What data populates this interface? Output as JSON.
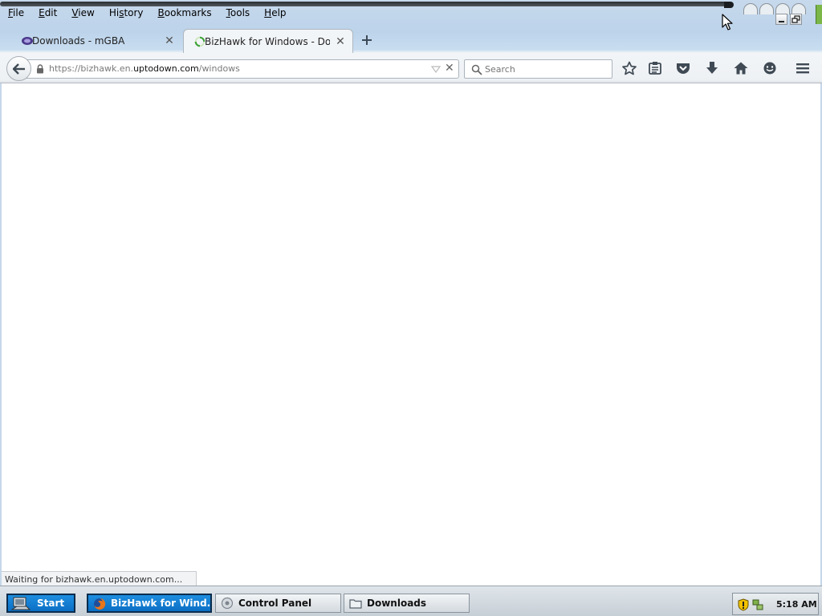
{
  "menu": [
    {
      "access": "F",
      "rest": "ile"
    },
    {
      "access": "E",
      "rest": "dit"
    },
    {
      "access": "V",
      "rest": "iew"
    },
    {
      "access": "H",
      "rest": "istory",
      "pre": "Hi",
      "post": "tory",
      "access_mid": "s"
    },
    {
      "access": "B",
      "rest": "ookmarks"
    },
    {
      "access": "T",
      "rest": "ools"
    },
    {
      "access": "H",
      "rest": "elp"
    }
  ],
  "tabs": [
    {
      "title": "Downloads - mGBA",
      "state": "inactive"
    },
    {
      "title": "BizHawk for Windows - Downl...",
      "state": "active",
      "loading": true
    }
  ],
  "nav": {
    "url_prefix": "https://bizhawk.en.",
    "url_domain": "uptodown.com",
    "url_suffix": "/windows",
    "search_placeholder": "Search"
  },
  "status_text": "Waiting for bizhawk.en.uptodown.com...",
  "taskbar": {
    "start_label": "Start",
    "tasks": [
      {
        "label": "BizHawk for Wind...",
        "active": true
      },
      {
        "label": "Control Panel",
        "active": false
      },
      {
        "label": "Downloads",
        "active": false
      }
    ],
    "clock": "5:18 AM"
  },
  "colors": {
    "accent": "#0b6fc4",
    "chrome": "#c7d9ec"
  }
}
